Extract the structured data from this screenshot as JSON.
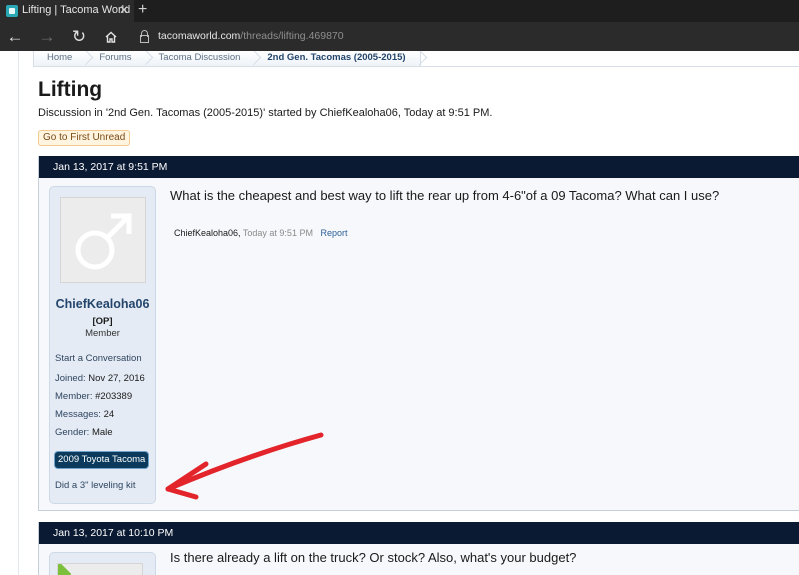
{
  "browser": {
    "tab_title": "Lifting | Tacoma World",
    "tab_close": "✕",
    "new_tab": "+",
    "url_domain": "tacomaworld.com",
    "url_path": "/threads/lifting.469870"
  },
  "breadcrumb": [
    "Home",
    "Forums",
    "Tacoma Discussion",
    "2nd Gen. Tacomas (2005-2015)"
  ],
  "thread": {
    "title": "Lifting",
    "description": "Discussion in '2nd Gen. Tacomas (2005-2015)' started by ChiefKealoha06, Today at 9:51 PM.",
    "first_unread_label": "Go to First Unread"
  },
  "posts": [
    {
      "date": "Jan 13, 2017 at 9:51 PM",
      "user": {
        "name": "ChiefKealoha06",
        "op_tag": "[OP]",
        "title": "Member",
        "start_conversation": "Start a Conversation",
        "joined_label": "Joined:",
        "joined_value": "Nov 27, 2016",
        "member_label": "Member:",
        "member_value": "#203389",
        "messages_label": "Messages:",
        "messages_value": "24",
        "gender_label": "Gender:",
        "gender_value": "Male",
        "vehicle": "2009 Toyota Tacoma",
        "signature": "Did a 3\" leveling kit"
      },
      "message": "What is the cheapest and best way to lift the rear up from 4-6\"of a 09 Tacoma? What can I use?",
      "meta_author": "ChiefKealoha06,",
      "meta_time": "Today at 9:51 PM",
      "meta_report": "Report"
    },
    {
      "date": "Jan 13, 2017 at 10:10 PM",
      "message": "Is there already a lift on the truck? Or stock? Also, what's your budget?"
    }
  ],
  "colors": {
    "post_header": "#0b1a33",
    "user_panel": "#e4ebf4",
    "username": "#23456b",
    "annotation_arrow": "#e3242b"
  },
  "icons": [
    "back-arrow-icon",
    "forward-arrow-icon",
    "refresh-icon",
    "home-icon",
    "lock-icon",
    "male-symbol-icon"
  ]
}
